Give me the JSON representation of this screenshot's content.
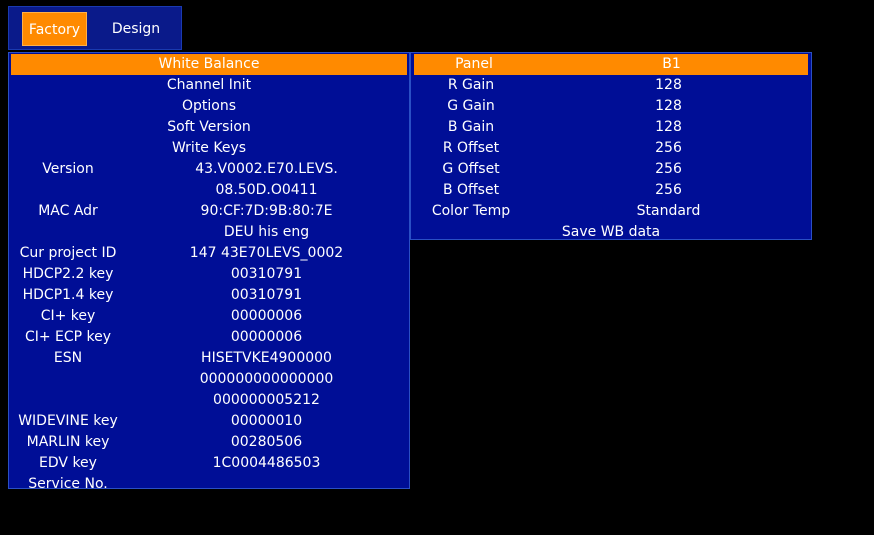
{
  "tabs": {
    "factory": "Factory",
    "design": "Design"
  },
  "colors": {
    "accent": "#ff8a00",
    "panel_bg": "#000e96",
    "panel_border": "#2a4fc4",
    "background": "#000000"
  },
  "left_menu": {
    "items": [
      "White Balance",
      "Channel Init",
      "Options",
      "Soft Version",
      "Write Keys"
    ],
    "info": [
      {
        "label": "Version",
        "value": "43.V0002.E70.LEVS."
      },
      {
        "label": "",
        "value": "08.50D.O0411"
      },
      {
        "label": "MAC Adr",
        "value": "90:CF:7D:9B:80:7E"
      },
      {
        "label": "",
        "value": "DEU his eng"
      },
      {
        "label": "Cur project ID",
        "value": "147 43E70LEVS_0002"
      },
      {
        "label": "HDCP2.2 key",
        "value": "00310791"
      },
      {
        "label": "HDCP1.4 key",
        "value": "00310791"
      },
      {
        "label": "CI+ key",
        "value": "00000006"
      },
      {
        "label": "CI+ ECP key",
        "value": "00000006"
      },
      {
        "label": "ESN",
        "value": "HISETVKE4900000"
      },
      {
        "label": "",
        "value": "000000000000000"
      },
      {
        "label": "",
        "value": "000000005212"
      },
      {
        "label": "WIDEVINE key",
        "value": "00000010"
      },
      {
        "label": "MARLIN key",
        "value": "00280506"
      },
      {
        "label": "EDV key",
        "value": "1C0004486503"
      },
      {
        "label": "Service No.",
        "value": ""
      }
    ]
  },
  "white_balance": {
    "rows": [
      {
        "label": "Panel",
        "value": "B1"
      },
      {
        "label": "R Gain",
        "value": "128"
      },
      {
        "label": "G Gain",
        "value": "128"
      },
      {
        "label": "B Gain",
        "value": "128"
      },
      {
        "label": "R Offset",
        "value": "256"
      },
      {
        "label": "G Offset",
        "value": "256"
      },
      {
        "label": "B Offset",
        "value": "256"
      },
      {
        "label": "Color Temp",
        "value": "Standard"
      }
    ],
    "save_label": "Save WB data"
  }
}
